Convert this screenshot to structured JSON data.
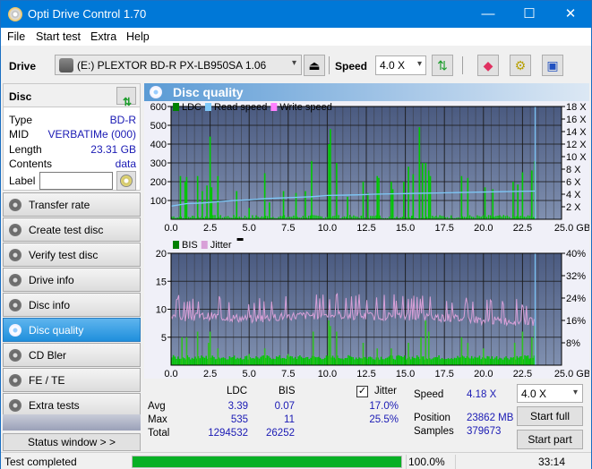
{
  "window": {
    "title": "Opti Drive Control 1.70",
    "minimize": "—",
    "maximize": "☐",
    "close": "✕"
  },
  "menu": [
    "File",
    "Start test",
    "Extra",
    "Help"
  ],
  "toolbar": {
    "drive_label": "Drive",
    "drive_value": "(E:)  PLEXTOR BD-R  PX-LB950SA 1.06",
    "speed_label": "Speed",
    "speed_value": "4.0 X",
    "eject_icon": "⏏"
  },
  "disc": {
    "header": "Disc",
    "rows": [
      {
        "key": "Type",
        "value": "BD-R"
      },
      {
        "key": "MID",
        "value": "VERBATIMe (000)"
      },
      {
        "key": "Length",
        "value": "23.31 GB"
      },
      {
        "key": "Contents",
        "value": "data"
      }
    ],
    "label_key": "Label",
    "label_value": ""
  },
  "nav": [
    {
      "label": "Transfer rate",
      "active": false
    },
    {
      "label": "Create test disc",
      "active": false
    },
    {
      "label": "Verify test disc",
      "active": false
    },
    {
      "label": "Drive info",
      "active": false
    },
    {
      "label": "Disc info",
      "active": false
    },
    {
      "label": "Disc quality",
      "active": true
    },
    {
      "label": "CD Bler",
      "active": false
    },
    {
      "label": "FE / TE",
      "active": false
    },
    {
      "label": "Extra tests",
      "active": false
    }
  ],
  "status_window_button": "Status window > >",
  "panel_title": "Disc quality",
  "colors": {
    "ldc": "#00c800",
    "read_speed": "#7ec8f8",
    "write_speed": "#ff80ff",
    "bis": "#00c800",
    "jitter": "#d8a0d8",
    "plot_bg_top": "#4a5a80",
    "plot_bg_bottom": "#8090b0",
    "accent": "#0078d7",
    "progress": "#06b025"
  },
  "chart_data": [
    {
      "type": "bar",
      "title": "LDC / Read speed",
      "legend": [
        "LDC",
        "Read speed",
        "Write speed"
      ],
      "legend_position": "top-left",
      "xlabel": "GB",
      "xlim": [
        0,
        25
      ],
      "x_ticks": [
        "0.0",
        "2.5",
        "5.0",
        "7.5",
        "10.0",
        "12.5",
        "15.0",
        "17.5",
        "20.0",
        "22.5",
        "25.0 GB"
      ],
      "ylim_left": [
        0,
        600
      ],
      "y_ticks_left": [
        "100",
        "200",
        "300",
        "400",
        "500",
        "600"
      ],
      "ylim_right": [
        0,
        18
      ],
      "y_ticks_right": [
        "2 X",
        "4 X",
        "6 X",
        "8 X",
        "10 X",
        "12 X",
        "14 X",
        "16 X",
        "18 X"
      ],
      "grid": true,
      "ldc_spikes": [
        [
          0.6,
          230
        ],
        [
          0.9,
          200
        ],
        [
          1.0,
          225
        ],
        [
          1.7,
          230
        ],
        [
          2.0,
          150
        ],
        [
          2.3,
          180
        ],
        [
          2.5,
          440
        ],
        [
          2.6,
          170
        ],
        [
          3.0,
          230
        ],
        [
          4.2,
          150
        ],
        [
          5.0,
          60
        ],
        [
          6.0,
          245
        ],
        [
          6.3,
          90
        ],
        [
          7.2,
          150
        ],
        [
          8.0,
          140
        ],
        [
          8.6,
          150
        ],
        [
          9.0,
          310
        ],
        [
          10.1,
          400
        ],
        [
          10.2,
          480
        ],
        [
          10.6,
          300
        ],
        [
          11.3,
          120
        ],
        [
          12.3,
          200
        ],
        [
          12.6,
          140
        ],
        [
          13.2,
          230
        ],
        [
          13.3,
          220
        ],
        [
          14.1,
          200
        ],
        [
          14.2,
          160
        ],
        [
          14.9,
          200
        ],
        [
          15.2,
          280
        ],
        [
          15.5,
          240
        ],
        [
          15.9,
          490
        ],
        [
          16.1,
          300
        ],
        [
          16.3,
          300
        ],
        [
          16.5,
          260
        ],
        [
          16.6,
          230
        ],
        [
          18.6,
          230
        ],
        [
          19.0,
          220
        ],
        [
          20.1,
          170
        ],
        [
          20.6,
          160
        ],
        [
          21.9,
          200
        ],
        [
          22.2,
          185
        ],
        [
          22.5,
          250
        ],
        [
          23.1,
          260
        ],
        [
          23.3,
          310
        ]
      ],
      "read_speed": [
        [
          0,
          2.1
        ],
        [
          1,
          2.5
        ],
        [
          2,
          2.6
        ],
        [
          3,
          2.8
        ],
        [
          4,
          3.0
        ],
        [
          5,
          3.1
        ],
        [
          6,
          3.3
        ],
        [
          7,
          3.4
        ],
        [
          8,
          3.5
        ],
        [
          9,
          3.6
        ],
        [
          10,
          3.8
        ],
        [
          11,
          3.85
        ],
        [
          12,
          3.9
        ],
        [
          13,
          4.0
        ],
        [
          14,
          4.05
        ],
        [
          15,
          4.1
        ],
        [
          16,
          4.15
        ],
        [
          17,
          4.2
        ],
        [
          18,
          4.25
        ],
        [
          19,
          4.3
        ],
        [
          20,
          4.35
        ],
        [
          21,
          4.4
        ],
        [
          22,
          4.45
        ],
        [
          23.3,
          4.5
        ]
      ],
      "end_marker_gb": 23.31
    },
    {
      "type": "bar",
      "title": "BIS / Jitter",
      "legend": [
        "BIS",
        "Jitter"
      ],
      "legend_position": "top-left",
      "xlabel": "GB",
      "xlim": [
        0,
        25
      ],
      "x_ticks": [
        "0.0",
        "2.5",
        "5.0",
        "7.5",
        "10.0",
        "12.5",
        "15.0",
        "17.5",
        "20.0",
        "22.5",
        "25.0 GB"
      ],
      "ylim_left": [
        0,
        20
      ],
      "y_ticks_left": [
        "5",
        "10",
        "15",
        "20"
      ],
      "ylim_right": [
        0,
        40
      ],
      "y_ticks_right": [
        "8%",
        "16%",
        "24%",
        "32%",
        "40%"
      ],
      "grid": true,
      "bis_spikes": [
        [
          0.7,
          5
        ],
        [
          1.0,
          5
        ],
        [
          1.7,
          6
        ],
        [
          2.4,
          4
        ],
        [
          2.5,
          6
        ],
        [
          3.0,
          3
        ],
        [
          5.0,
          2
        ],
        [
          6.0,
          3
        ],
        [
          7.5,
          2
        ],
        [
          9.1,
          6
        ],
        [
          10.1,
          8
        ],
        [
          10.2,
          7
        ],
        [
          10.6,
          6
        ],
        [
          12.3,
          4
        ],
        [
          13.2,
          3
        ],
        [
          14.1,
          3
        ],
        [
          15.2,
          4
        ],
        [
          16.0,
          5
        ],
        [
          16.3,
          8
        ],
        [
          16.5,
          6
        ],
        [
          18.6,
          5
        ],
        [
          19.0,
          4
        ],
        [
          20.0,
          3
        ],
        [
          22.0,
          4
        ],
        [
          22.5,
          6
        ],
        [
          23.1,
          5
        ],
        [
          23.3,
          7
        ]
      ],
      "jitter_pct_baseline": [
        [
          0,
          17
        ],
        [
          2.5,
          17.5
        ],
        [
          5,
          16.5
        ],
        [
          7.5,
          17.5
        ],
        [
          10,
          18
        ],
        [
          12.5,
          17.5
        ],
        [
          15,
          17.5
        ],
        [
          17.5,
          17
        ],
        [
          20,
          16
        ],
        [
          23.3,
          15.5
        ]
      ],
      "jitter_pct_peak": 25.5,
      "end_marker_gb": 23.31
    }
  ],
  "stats": {
    "col_ldc": "LDC",
    "col_bis": "BIS",
    "jitter_checked": true,
    "jitter_label": "Jitter",
    "rows": [
      {
        "label": "Avg",
        "ldc": "3.39",
        "bis": "0.07",
        "jitter": "17.0%"
      },
      {
        "label": "Max",
        "ldc": "535",
        "bis": "11",
        "jitter": "25.5%"
      },
      {
        "label": "Total",
        "ldc": "1294532",
        "bis": "26252",
        "jitter": ""
      }
    ],
    "speed_label": "Speed",
    "speed_value": "4.18 X",
    "position_label": "Position",
    "position_value": "23862 MB",
    "samples_label": "Samples",
    "samples_value": "379673",
    "speed_select": "4.0 X",
    "start_full": "Start full",
    "start_part": "Start part"
  },
  "statusbar": {
    "message": "Test completed",
    "progress": 1.0,
    "progress_text": "100.0%",
    "time": "33:14"
  }
}
